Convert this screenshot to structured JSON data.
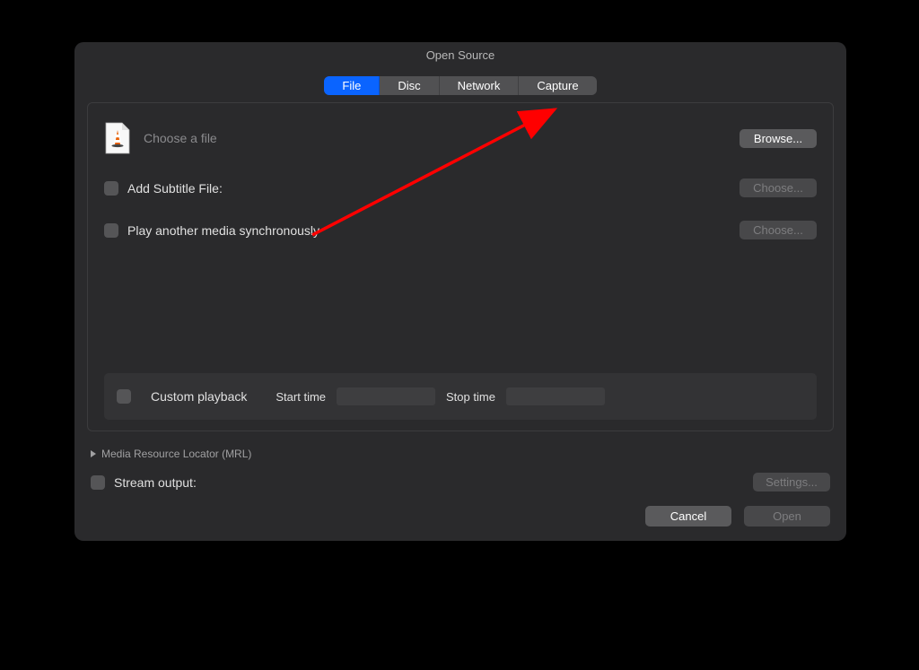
{
  "window": {
    "title": "Open Source"
  },
  "tabs": {
    "file": "File",
    "disc": "Disc",
    "network": "Network",
    "capture": "Capture",
    "active": 0
  },
  "file_panel": {
    "choose_label": "Choose a file",
    "browse_button": "Browse...",
    "subtitle_label": "Add Subtitle File:",
    "subtitle_choose": "Choose...",
    "sync_label": "Play another media synchronously",
    "sync_choose": "Choose...",
    "custom_playback_label": "Custom playback",
    "start_time_label": "Start time",
    "start_time_value": "",
    "stop_time_label": "Stop time",
    "stop_time_value": ""
  },
  "mrl": {
    "label": "Media Resource Locator (MRL)"
  },
  "stream": {
    "label": "Stream output:",
    "settings_button": "Settings..."
  },
  "footer": {
    "cancel": "Cancel",
    "open": "Open"
  },
  "annotation": {
    "type": "arrow",
    "color": "#ff0000"
  }
}
